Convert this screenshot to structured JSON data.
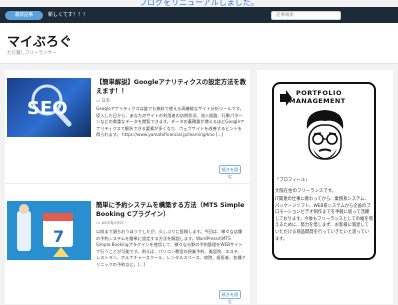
{
  "notice": "ブログをリニューアルしました。",
  "topbar": {
    "badge": "最新記事",
    "message": "新しくてす！！！",
    "search_placeholder": "記事検索"
  },
  "site": {
    "title": "マイぶろぐ",
    "description": "ただ寝しフリーランサー"
  },
  "articles": [
    {
      "title": "【簡単解説】Googleアナリティクスの設定方法を教えます！！",
      "category": "日系",
      "thumb_text": "SEO",
      "body": "Googleアナリティクスは誰でも無料で使える高機能なサイト分析ツールです。導入した日から、あなたのサイトの利用者の訪問状況、流入経路、行動パターンなどの貴重なデータを閲覧できます。データの蓄積量が増えるほどGoogleアナリティクスで解析できる要素が多くなり、ウェブサイトを改善するヒントを得られます。 https://www.yamatofinancial.jp/learning/kno [...]",
      "more": "続きを読む"
    },
    {
      "title": "簡単に予約システムを構築する方法（MTS Simple Booking Cプラグイン）",
      "category": "wordpress",
      "thumb_text": "7",
      "body": "以前まで頭ちおうほうでしたが、久しぶりに投稿します。今回は、様々な店舗の予約システムを簡単に設定する方法を解説します。WordPressのMTS Simple Bookingプラグインを使用して、様々な分野の予約管理をWEBサイトで行うことが可能です。例えば、パソコン教室の授業予約、美容院、エステ、レストラン、ホルナチャースクール、レンタルスペース、病院、歯医者、各種クリニックの予約など。[...]",
      "more": "続きを読む"
    }
  ],
  "sidebar": {
    "portfolio_line1": "PORTFOLIO",
    "portfolio_line2": "MANAGEMENT",
    "profile_label": "「プロフィール」",
    "name": "大阪在住のフリーランスです。",
    "description": "IT関連の仕事に携わってから、業務系システム、パッケージソフト、WEB系システムから企画のプロモーションビデオ制作までを手軽に扱って活躍しております。今後もフリーランスとしての幅を増えるために、努力を惜しまず、お客様に満足していただける商品開発を行っていきたいと思っています。"
  },
  "colors": {
    "topbar": "#1d2b38",
    "badge": "#5aa2db",
    "notice": "#2a7be0",
    "more_button": "#3a7cc2"
  }
}
